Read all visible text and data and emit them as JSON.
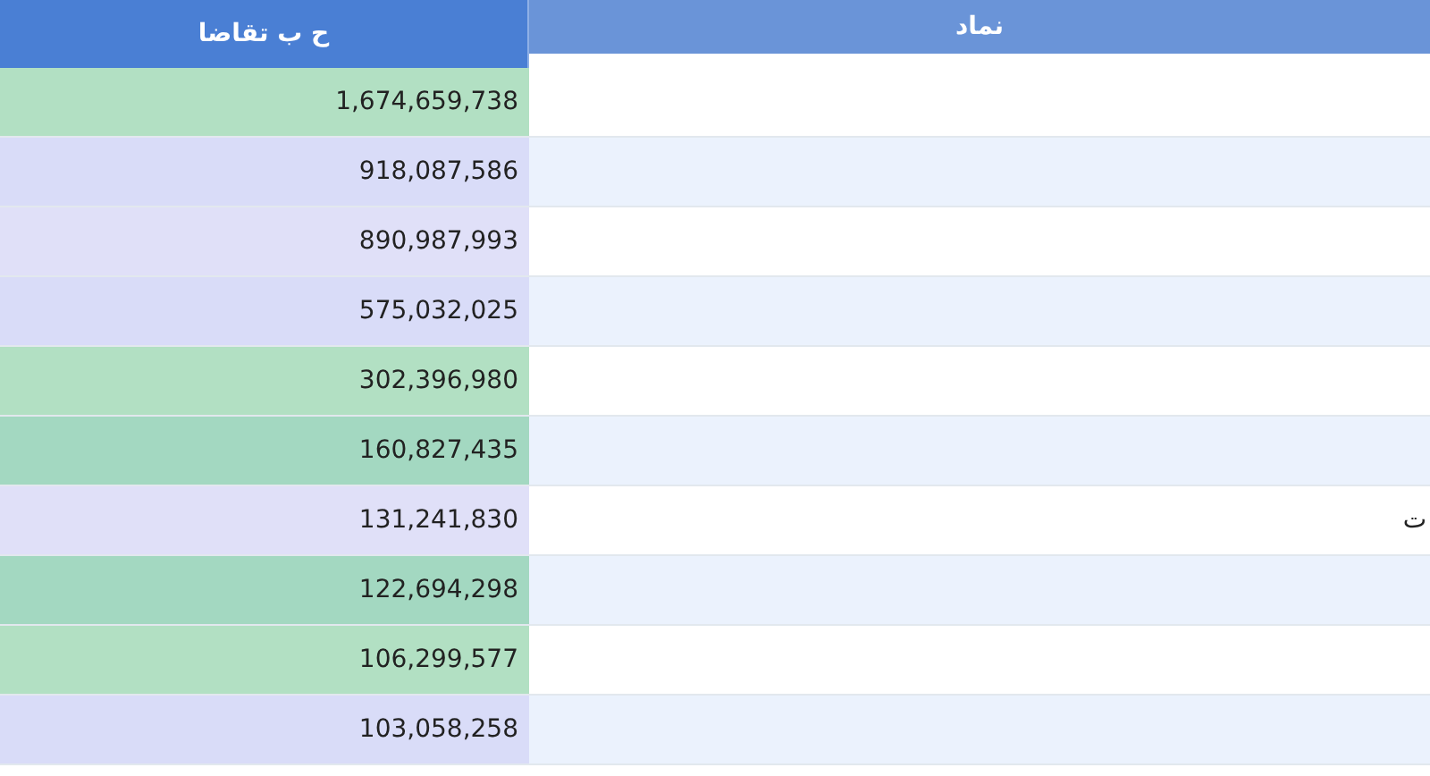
{
  "table": {
    "columns": [
      "نماد",
      "ح ب تقاضا"
    ],
    "rows": [
      {
        "value": "1,674,659,738",
        "color": "#b2e0c3"
      },
      {
        "value": "918,087,586",
        "color": "#d9dcf8"
      },
      {
        "value": "890,987,993",
        "color": "#e0e0f8"
      },
      {
        "value": "575,032,025",
        "color": "#d9dcf8"
      },
      {
        "value": "302,396,980",
        "color": "#b2e0c3"
      },
      {
        "value": "160,827,435",
        "color": "#a3d8c1"
      },
      {
        "value": "131,241,830",
        "color": "#e0e0f8",
        "symbol": "ت"
      },
      {
        "value": "122,694,298",
        "color": "#a3d8c1"
      },
      {
        "value": "106,299,577",
        "color": "#b2e0c3"
      },
      {
        "value": "103,058,258",
        "color": "#d9dcf8"
      }
    ]
  }
}
